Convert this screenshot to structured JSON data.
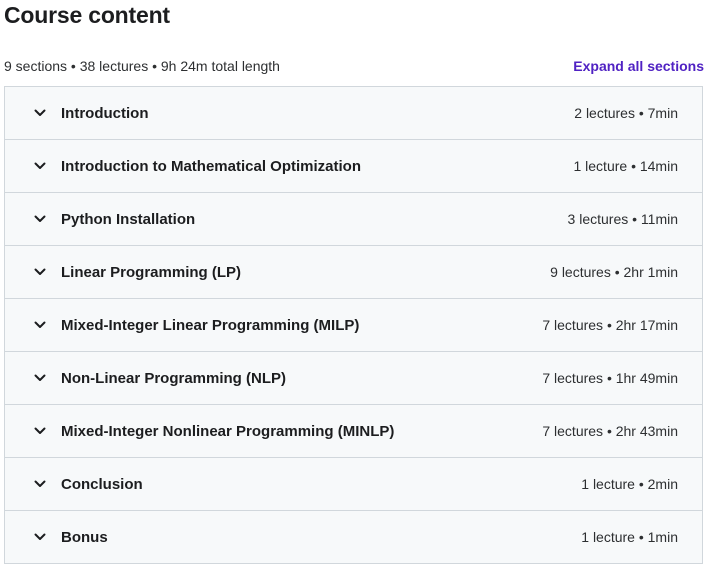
{
  "header": {
    "title": "Course content",
    "summary": "9 sections • 38 lectures • 9h 24m total length",
    "expand_label": "Expand all sections"
  },
  "icons": {
    "section_toggle": "chevron-down-icon"
  },
  "colors": {
    "accent": "#5022c3",
    "section_bg": "#f7f9fa",
    "border": "#d1d7dc"
  },
  "sections": [
    {
      "title": "Introduction",
      "meta": "2 lectures • 7min"
    },
    {
      "title": "Introduction to Mathematical Optimization",
      "meta": "1 lecture • 14min"
    },
    {
      "title": "Python Installation",
      "meta": "3 lectures • 11min"
    },
    {
      "title": "Linear Programming (LP)",
      "meta": "9 lectures • 2hr 1min"
    },
    {
      "title": "Mixed-Integer Linear Programming (MILP)",
      "meta": "7 lectures • 2hr 17min"
    },
    {
      "title": "Non-Linear Programming (NLP)",
      "meta": "7 lectures • 1hr 49min"
    },
    {
      "title": "Mixed-Integer Nonlinear Programming (MINLP)",
      "meta": "7 lectures • 2hr 43min"
    },
    {
      "title": "Conclusion",
      "meta": "1 lecture • 2min"
    },
    {
      "title": "Bonus",
      "meta": "1 lecture • 1min"
    }
  ]
}
